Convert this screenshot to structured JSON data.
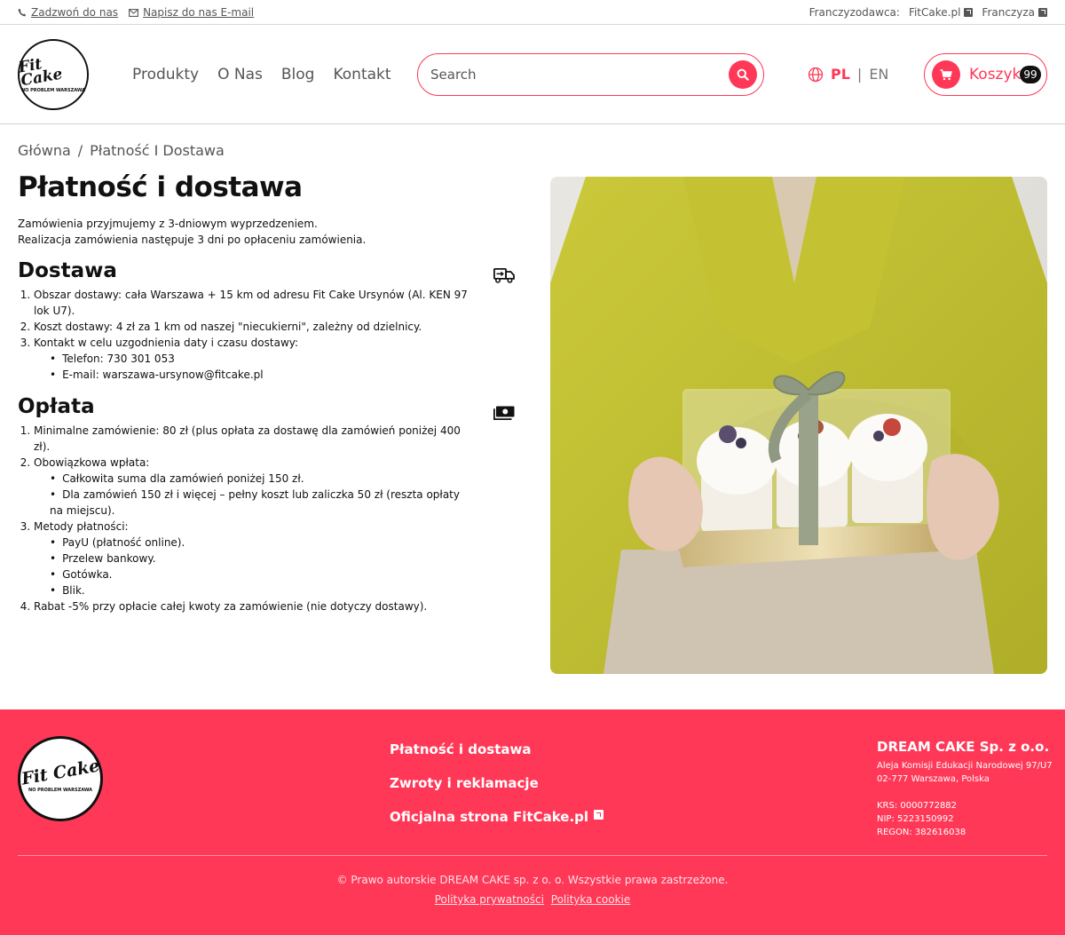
{
  "topbar": {
    "call_label": "Zadzwoń do nas",
    "email_label": "Napisz do nas E-mail",
    "franchisor_label": "Franczyzodawca:",
    "franchisor_link": "FitCake.pl",
    "franchise_link": "Franczyza"
  },
  "header": {
    "logo_text": "Fit Cake",
    "logo_sub": "NO PROBLEM WARSZAWA",
    "nav": [
      "Produkty",
      "O Nas",
      "Blog",
      "Kontakt"
    ],
    "search_placeholder": "Search",
    "lang_pl": "PL",
    "lang_sep": "|",
    "lang_en": "EN",
    "cart_label": "Koszyk",
    "cart_count": "99"
  },
  "breadcrumb": {
    "home": "Główna",
    "sep": "/",
    "current": "Płatność I Dostawa"
  },
  "main": {
    "title": "Płatność i dostawa",
    "intro_1": "Zamówienia przyjmujemy z 3-dniowym wyprzedzeniem.",
    "intro_2": "Realizacja zamówienia następuje 3 dni po opłaceniu zamówienia.",
    "delivery": {
      "title": "Dostawa",
      "item_1": "Obszar dostawy: cała Warszawa + 15 km od adresu Fit Cake Ursynów (Al. KEN 97 lok U7).",
      "item_2": "Koszt dostawy: 4 zł za 1 km od naszej \"niecukierni\", zależny od dzielnicy.",
      "item_3": "Kontakt w celu uzgodnienia daty i czasu dostawy:",
      "sub_1": "Telefon: 730 301 053",
      "sub_2": "E-mail: warszawa-ursynow@fitcake.pl"
    },
    "payment": {
      "title": "Opłata",
      "item_1": "Minimalne zamówienie: 80 zł (plus opłata za dostawę dla zamówień poniżej 400 zł).",
      "item_2": "Obowiązkowa wpłata:",
      "item_2_sub_1": "Całkowita suma dla zamówień poniżej 150 zł.",
      "item_2_sub_2": "Dla zamówień 150 zł i więcej – pełny koszt lub zaliczka 50 zł (reszta opłaty na miejscu).",
      "item_3": "Metody płatności:",
      "item_3_sub_1": "PayU (płatność online).",
      "item_3_sub_2": "Przelew bankowy.",
      "item_3_sub_3": "Gotówka.",
      "item_3_sub_4": "Blik.",
      "item_4": "Rabat -5% przy opłacie całej kwoty za zamówienie (nie dotyczy dostawy)."
    }
  },
  "footer": {
    "link_1": "Płatność i dostawa",
    "link_2": "Zwroty i reklamacje",
    "link_3": "Oficjalna strona FitCake.pl",
    "company_name": "DREAM CAKE Sp. z o.o.",
    "address_1": "Aleja Komisji Edukacji Narodowej 97/U7",
    "address_2": "02-777 Warszawa, Polska",
    "krs": "KRS: 0000772882",
    "nip": "NIP: 5223150992",
    "regon": "REGON: 382616038",
    "copyright": "© Prawo autorskie DREAM CAKE sp. z o. o. Wszystkie prawa zastrzeżone.",
    "privacy": "Polityka prywatności",
    "cookie": "Polityka cookie"
  },
  "colors": {
    "accent": "#ff3857",
    "text": "#111111",
    "muted": "#555555"
  },
  "icons": [
    "phone-icon",
    "mail-icon",
    "external-link-icon",
    "search-icon",
    "globe-icon",
    "cart-icon",
    "delivery-truck-icon",
    "money-icon"
  ]
}
